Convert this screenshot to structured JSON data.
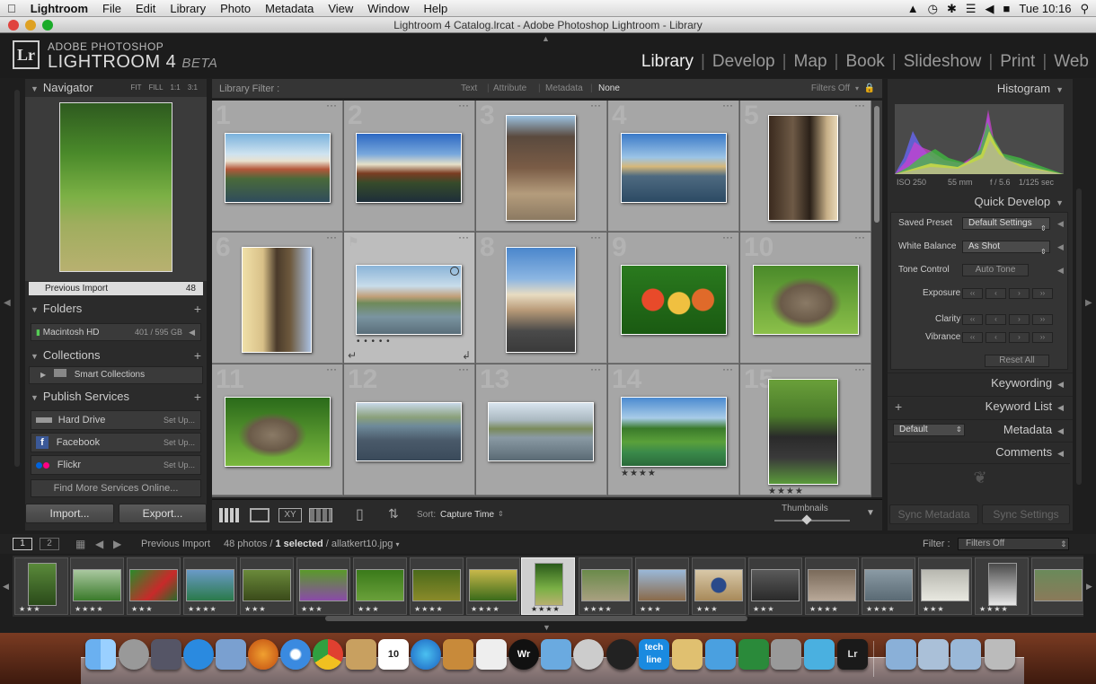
{
  "menubar": {
    "app": "Lightroom",
    "items": [
      "File",
      "Edit",
      "Library",
      "Photo",
      "Metadata",
      "View",
      "Window",
      "Help"
    ],
    "clock": "Tue 10:16"
  },
  "window": {
    "title": "Lightroom 4 Catalog.lrcat - Adobe Photoshop Lightroom - Library"
  },
  "identity": {
    "logo": "Lr",
    "line1": "ADOBE PHOTOSHOP",
    "line2": "LIGHTROOM 4",
    "beta": "BETA"
  },
  "modules": [
    "Library",
    "Develop",
    "Map",
    "Book",
    "Slideshow",
    "Print",
    "Web"
  ],
  "navigator": {
    "title": "Navigator",
    "zoom": [
      "FIT",
      "FILL",
      "1:1",
      "3:1"
    ]
  },
  "catalog": {
    "label": "Previous Import",
    "count": "48"
  },
  "folders": {
    "title": "Folders",
    "volume": "Macintosh HD",
    "space": "401 / 595 GB"
  },
  "collections": {
    "title": "Collections",
    "smart": "Smart Collections"
  },
  "publish": {
    "title": "Publish Services",
    "services": [
      {
        "name": "Hard Drive",
        "action": "Set Up..."
      },
      {
        "name": "Facebook",
        "action": "Set Up..."
      },
      {
        "name": "Flickr",
        "action": "Set Up..."
      }
    ],
    "find_more": "Find More Services Online..."
  },
  "buttons": {
    "import": "Import...",
    "export": "Export..."
  },
  "filterbar": {
    "title": "Library Filter :",
    "options": [
      "Text",
      "Attribute",
      "Metadata",
      "None"
    ],
    "preset": "Filters Off"
  },
  "grid": {
    "numbers": [
      "1",
      "2",
      "3",
      "4",
      "5",
      "6",
      "7",
      "8",
      "9",
      "10",
      "11",
      "12",
      "13",
      "14",
      "15"
    ],
    "stars14": "★★★★",
    "stars15": "★★★★",
    "dots7": "• • • • •"
  },
  "toolbar": {
    "sort_label": "Sort:",
    "sort_value": "Capture Time",
    "thumbnails": "Thumbnails"
  },
  "histogram": {
    "title": "Histogram",
    "iso": "ISO 250",
    "focal": "55 mm",
    "aperture": "f / 5.6",
    "shutter": "1/125 sec"
  },
  "quick_develop": {
    "title": "Quick Develop",
    "saved_preset": "Saved Preset",
    "saved_preset_value": "Default Settings",
    "white_balance": "White Balance",
    "white_balance_value": "As Shot",
    "tone_control": "Tone Control",
    "auto_tone": "Auto Tone",
    "exposure": "Exposure",
    "clarity": "Clarity",
    "vibrance": "Vibrance",
    "reset_all": "Reset All"
  },
  "right_sections": {
    "keywording": "Keywording",
    "keyword_list": "Keyword List",
    "metadata": "Metadata",
    "metadata_preset": "Default",
    "comments": "Comments"
  },
  "sync": {
    "metadata": "Sync Metadata",
    "settings": "Sync Settings"
  },
  "filmstrip_bar": {
    "page1": "1",
    "page2": "2",
    "source": "Previous Import",
    "count_text": "48 photos /",
    "selected": "1 selected",
    "filename": "/ allatkert10.jpg",
    "filter_label": "Filter :",
    "filter_value": "Filters Off"
  },
  "filmstrip": {
    "stars": [
      "★★★",
      "★★★★",
      "★★★",
      "★★★★",
      "★★★",
      "★★★",
      "★★★",
      "★★★★",
      "★★★★",
      "★★★★",
      "★★★★",
      "★★★",
      "★★★",
      "★★★",
      "★★★★",
      "★★★★",
      "★★★",
      "★★★★"
    ]
  },
  "dock": {
    "techline": "tech line",
    "calendar": "10",
    "lr": "Lr",
    "wr": "Wr"
  }
}
